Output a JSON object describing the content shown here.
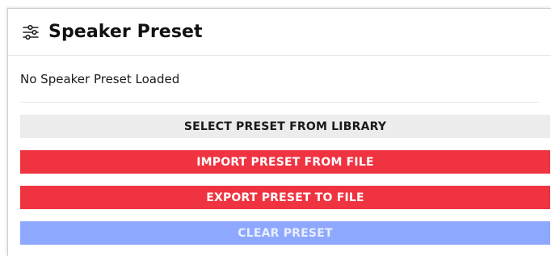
{
  "panel": {
    "title": "Speaker Preset",
    "icon": "sliders-icon",
    "status_text": "No Speaker Preset Loaded"
  },
  "buttons": {
    "select_label": "SELECT PRESET FROM LIBRARY",
    "import_label": "IMPORT PRESET FROM FILE",
    "export_label": "EXPORT PRESET TO FILE",
    "clear_label": "CLEAR PRESET"
  },
  "colors": {
    "select_bg": "#ececec",
    "primary_red": "#ef3340",
    "clear_bg": "#8ea8ff"
  }
}
